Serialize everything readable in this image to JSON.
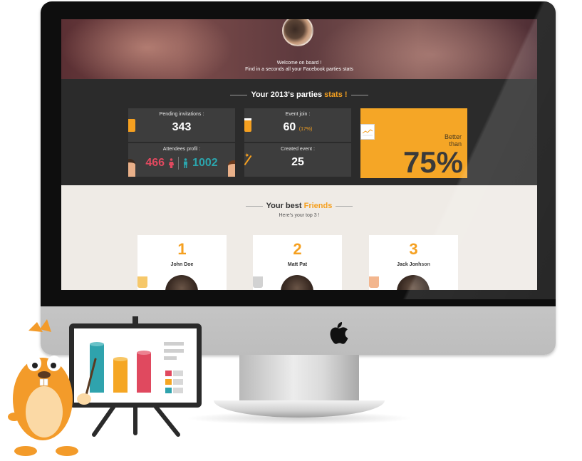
{
  "hero": {
    "line1": "Welcome on board !",
    "line2": "Find in a seconds all your Facebook parties stats"
  },
  "stats": {
    "title_prefix": "Your 2013's parties",
    "title_accent": "stats !",
    "pending_label": "Pending invitations :",
    "pending_value": "343",
    "event_join_label": "Event join :",
    "event_join_value": "60",
    "event_join_percent": "(17%)",
    "attendees_label": "Attendees profil :",
    "attendees_female": "466",
    "attendees_male": "1002",
    "created_label": "Created event :",
    "created_value": "25",
    "better_line1": "Better",
    "better_line2": "than",
    "better_value": "75%"
  },
  "friends": {
    "title_prefix": "Your best",
    "title_accent": "Friends",
    "subtitle": "Here's your top 3 !",
    "items": [
      {
        "rank": "1",
        "name": "John Doe"
      },
      {
        "rank": "2",
        "name": "Matt Pat"
      },
      {
        "rank": "3",
        "name": "Jack Jonhson"
      }
    ]
  },
  "colors": {
    "accent": "#f5a020",
    "pink": "#e0495f",
    "teal": "#2ba5ad",
    "dark": "#2b2b2b"
  },
  "icons": [
    "apple-logo-icon",
    "envelope-icon",
    "beer-glass-icon",
    "magic-wand-icon",
    "female-icon",
    "male-icon",
    "coffee-mug-icon"
  ]
}
